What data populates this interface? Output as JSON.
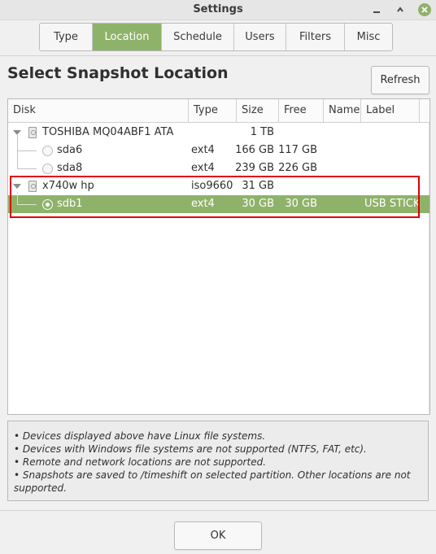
{
  "window": {
    "title": "Settings"
  },
  "tabs": [
    {
      "label": "Type"
    },
    {
      "label": "Location"
    },
    {
      "label": "Schedule"
    },
    {
      "label": "Users"
    },
    {
      "label": "Filters"
    },
    {
      "label": "Misc"
    }
  ],
  "active_tab": "Location",
  "heading": "Select Snapshot Location",
  "refresh_label": "Refresh",
  "columns": {
    "disk": "Disk",
    "type": "Type",
    "size": "Size",
    "free": "Free",
    "name": "Name",
    "label": "Label"
  },
  "devices": [
    {
      "name": "TOSHIBA MQ04ABF1 ATA",
      "type": "",
      "size": "1 TB",
      "free": "",
      "vol_name": "",
      "label": ""
    },
    {
      "name": "sda6",
      "type": "ext4",
      "size": "166 GB",
      "free": "117 GB",
      "vol_name": "",
      "label": ""
    },
    {
      "name": "sda8",
      "type": "ext4",
      "size": "239 GB",
      "free": "226 GB",
      "vol_name": "",
      "label": ""
    },
    {
      "name": "x740w hp",
      "type": "iso9660",
      "size": "31 GB",
      "free": "",
      "vol_name": "",
      "label": ""
    },
    {
      "name": "sdb1",
      "type": "ext4",
      "size": "30 GB",
      "free": "30 GB",
      "vol_name": "",
      "label": "USB STICK"
    }
  ],
  "selected_device": "sdb1",
  "notes": [
    "• Devices displayed above have Linux file systems.",
    "• Devices with Windows file systems are not supported (NTFS, FAT, etc).",
    "• Remote and network locations are not supported.",
    "• Snapshots are saved to /timeshift on selected partition. Other locations are not supported."
  ],
  "ok_label": "OK",
  "colors": {
    "accent": "#8fb26a",
    "highlight_box": "#dd0000"
  },
  "icons": {
    "minimize": "minimize-icon",
    "maximize": "maximize-icon",
    "close": "close-icon",
    "disk": "disk-icon",
    "expander": "expander-arrow-icon"
  }
}
